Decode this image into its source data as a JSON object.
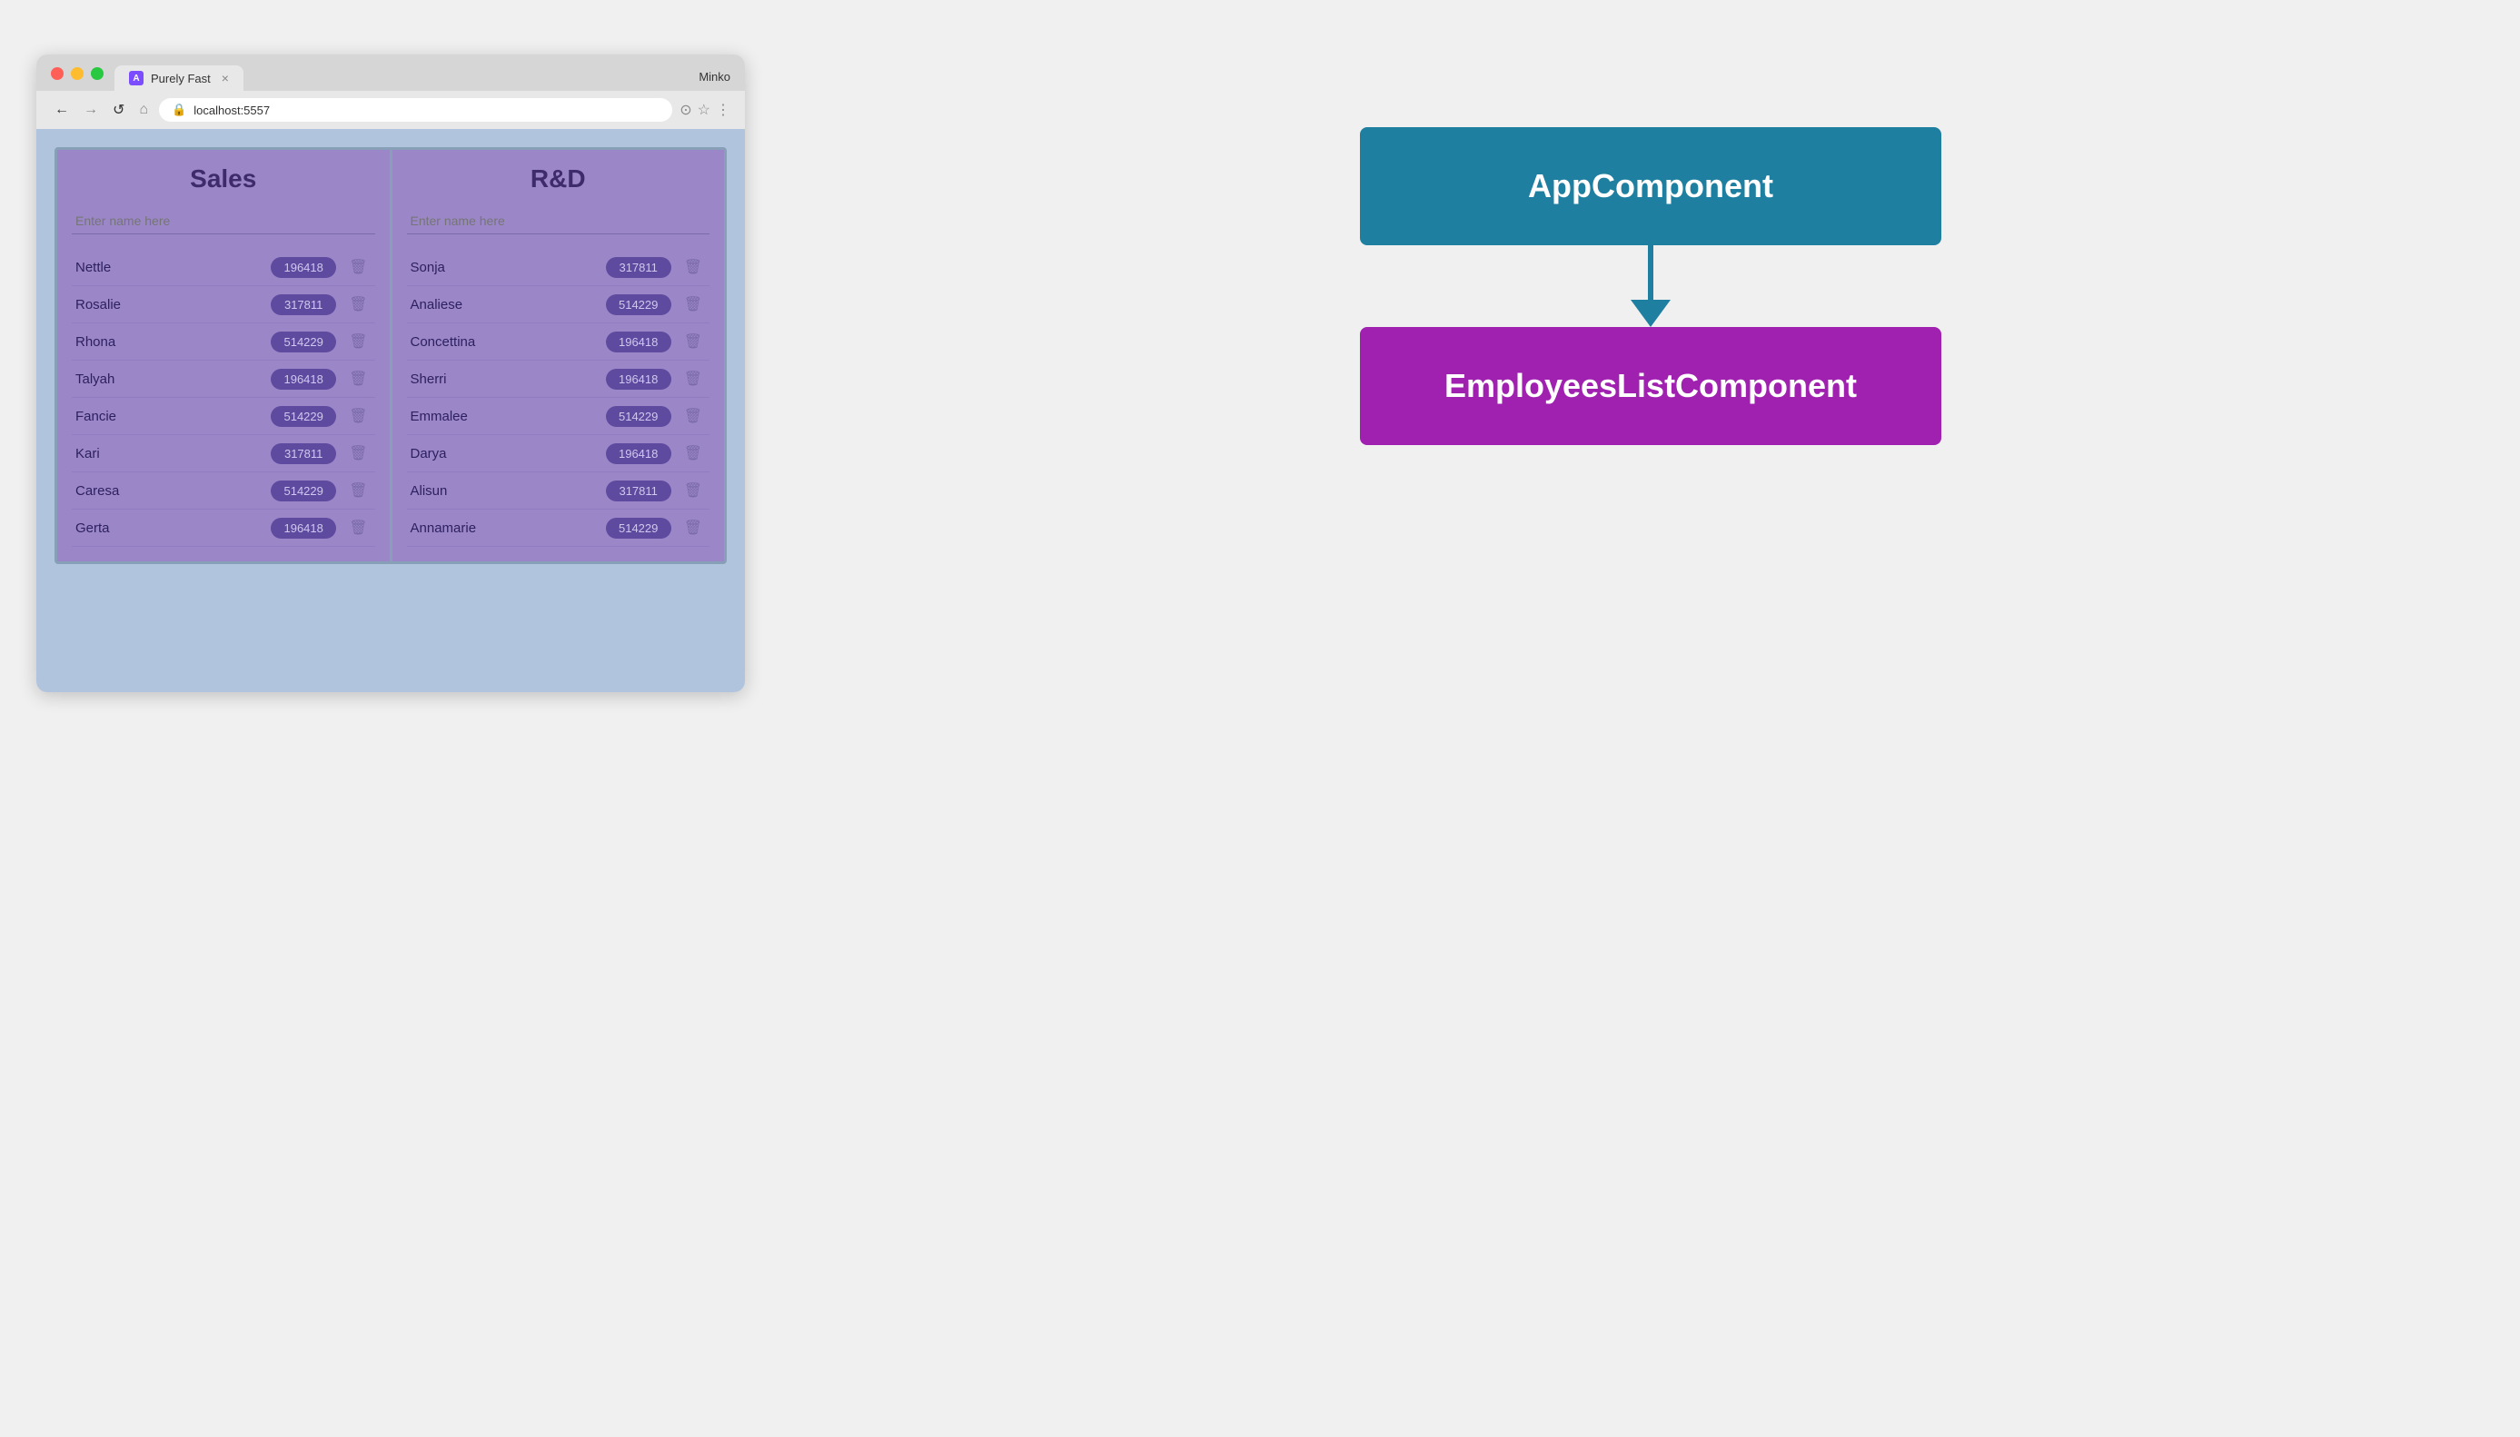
{
  "browser": {
    "tab_title": "Purely Fast",
    "tab_icon_letter": "A",
    "url": "localhost:5557",
    "user": "Minko",
    "close_symbol": "×"
  },
  "nav": {
    "back": "←",
    "forward": "→",
    "reload": "↺",
    "home": "⌂",
    "more": "⋮"
  },
  "app": {
    "departments": [
      {
        "id": "sales",
        "title": "Sales",
        "input_placeholder": "Enter name here",
        "employees": [
          {
            "name": "Nettle",
            "badge": "196418"
          },
          {
            "name": "Rosalie",
            "badge": "317811"
          },
          {
            "name": "Rhona",
            "badge": "514229"
          },
          {
            "name": "Talyah",
            "badge": "196418"
          },
          {
            "name": "Fancie",
            "badge": "514229"
          },
          {
            "name": "Kari",
            "badge": "317811"
          },
          {
            "name": "Caresa",
            "badge": "514229"
          },
          {
            "name": "Gerta",
            "badge": "196418"
          }
        ]
      },
      {
        "id": "rd",
        "title": "R&D",
        "input_placeholder": "Enter name here",
        "employees": [
          {
            "name": "Sonja",
            "badge": "317811"
          },
          {
            "name": "Analiese",
            "badge": "514229"
          },
          {
            "name": "Concettina",
            "badge": "196418"
          },
          {
            "name": "Sherri",
            "badge": "196418"
          },
          {
            "name": "Emmalee",
            "badge": "514229"
          },
          {
            "name": "Darya",
            "badge": "196418"
          },
          {
            "name": "Alisun",
            "badge": "317811"
          },
          {
            "name": "Annamarie",
            "badge": "514229"
          }
        ]
      }
    ]
  },
  "diagram": {
    "app_component_label": "AppComponent",
    "employees_component_label": "EmployeesListComponent",
    "colors": {
      "app_bg": "#1e7fa0",
      "employees_bg": "#a020b0",
      "arrow": "#1e7fa0"
    }
  }
}
